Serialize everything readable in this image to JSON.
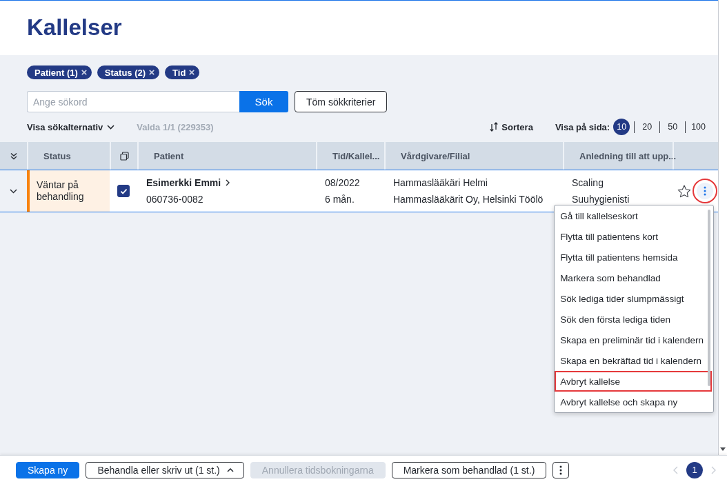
{
  "header": {
    "title": "Kallelser"
  },
  "filters": [
    {
      "label": "Patient (1)"
    },
    {
      "label": "Status (2)"
    },
    {
      "label": "Tid"
    }
  ],
  "search": {
    "placeholder": "Ange sökord",
    "button": "Sök",
    "clear_button": "Töm sökkriterier"
  },
  "toolbar": {
    "options_toggle": {
      "label": "Visa sökalternativ",
      "expanded": false
    },
    "selection_count": "Valda 1/1 (229353)",
    "sort_button": "Sortera",
    "page_size_label": "Visa på sida:",
    "page_sizes": [
      {
        "label": "10",
        "selected": true
      },
      {
        "label": "20",
        "selected": false
      },
      {
        "label": "50",
        "selected": false
      },
      {
        "label": "100",
        "selected": false
      }
    ]
  },
  "table": {
    "columns": [
      {
        "kind": "expand"
      },
      {
        "kind": "text",
        "label": "Status"
      },
      {
        "kind": "select"
      },
      {
        "kind": "text",
        "label": "Patient"
      },
      {
        "kind": "text",
        "label": "Tid/Kallel..."
      },
      {
        "kind": "text",
        "label": "Vårdgivare/Filial"
      },
      {
        "kind": "text",
        "label": "Anledning till att upp..."
      },
      {
        "kind": "actions"
      }
    ],
    "rows": [
      {
        "expanded": false,
        "status": {
          "label": "Väntar på behandling",
          "color": "#f7820d"
        },
        "checked": true,
        "patient": {
          "name": "Esimerkki Emmi",
          "id": "060736-0082"
        },
        "time": {
          "date": "08/2022",
          "interval": "6 mån."
        },
        "provider": {
          "name": "Hammaslääkäri Helmi",
          "clinic": "Hammaslääkärit Oy, Helsinki Töölö"
        },
        "reason": {
          "name": "Scaling",
          "role": "Suuhygienisti"
        },
        "starred": false,
        "actions_highlighted": true,
        "menu_open": true
      }
    ]
  },
  "context_menu": {
    "items": [
      {
        "label": "Gå till kallelseskort",
        "highlighted": false
      },
      {
        "label": "Flytta till patientens kort",
        "highlighted": false
      },
      {
        "label": "Flytta till patientens hemsida",
        "highlighted": false
      },
      {
        "label": "Markera som behandlad",
        "highlighted": false
      },
      {
        "label": "Sök lediga tider slumpmässigt",
        "highlighted": false
      },
      {
        "label": "Sök den första lediga tiden",
        "highlighted": false
      },
      {
        "label": "Skapa en preliminär tid i kalendern",
        "highlighted": false
      },
      {
        "label": "Skapa en bekräftad tid i kalendern",
        "highlighted": false
      },
      {
        "label": "Avbryt kallelse",
        "highlighted": true
      },
      {
        "label": "Avbryt kallelse och skapa ny",
        "highlighted": false
      }
    ]
  },
  "footer": {
    "buttons": [
      {
        "kind": "primary",
        "label": "Skapa ny",
        "disabled": false
      },
      {
        "kind": "dropdown",
        "label": "Behandla eller skriv ut (1 st.)",
        "disabled": false
      },
      {
        "kind": "outline",
        "label": "Annullera tidsbokningarna",
        "disabled": true
      },
      {
        "kind": "outline",
        "label": "Markera som behandlad (1 st.)",
        "disabled": false
      },
      {
        "kind": "more",
        "disabled": false
      }
    ],
    "pagination": {
      "pages": [
        {
          "label": "1",
          "selected": true
        }
      ],
      "prev_disabled": true,
      "next_disabled": true
    }
  }
}
